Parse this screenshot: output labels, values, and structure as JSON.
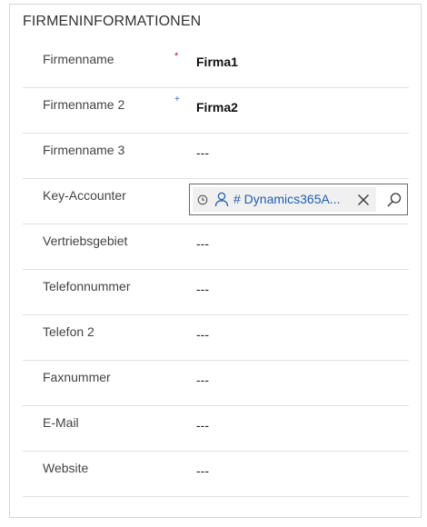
{
  "section": {
    "title": "FIRMENINFORMATIONEN"
  },
  "required_markers": {
    "required": "*",
    "recommended": "+"
  },
  "fields": {
    "firmenname": {
      "label": "Firmenname",
      "value": "Firma1"
    },
    "firmenname2": {
      "label": "Firmenname 2",
      "value": "Firma2"
    },
    "firmenname3": {
      "label": "Firmenname 3",
      "value": "---"
    },
    "key_accounter": {
      "label": "Key-Accounter",
      "lookup_value": "# Dynamics365A...",
      "icons": [
        "clock-icon",
        "person-icon",
        "close-icon",
        "search-icon"
      ]
    },
    "vertriebsgebiet": {
      "label": "Vertriebsgebiet",
      "value": "---"
    },
    "telefonnummer": {
      "label": "Telefonnummer",
      "value": "---"
    },
    "telefon2": {
      "label": "Telefon 2",
      "value": "---"
    },
    "faxnummer": {
      "label": "Faxnummer",
      "value": "---"
    },
    "email": {
      "label": "E-Mail",
      "value": "---"
    },
    "website": {
      "label": "Website",
      "value": "---"
    }
  },
  "colors": {
    "required_star": "#c50f1f",
    "recommended_plus": "#2266e3",
    "lookup_link": "#1f5fb4",
    "divider": "#e1e1e1"
  }
}
